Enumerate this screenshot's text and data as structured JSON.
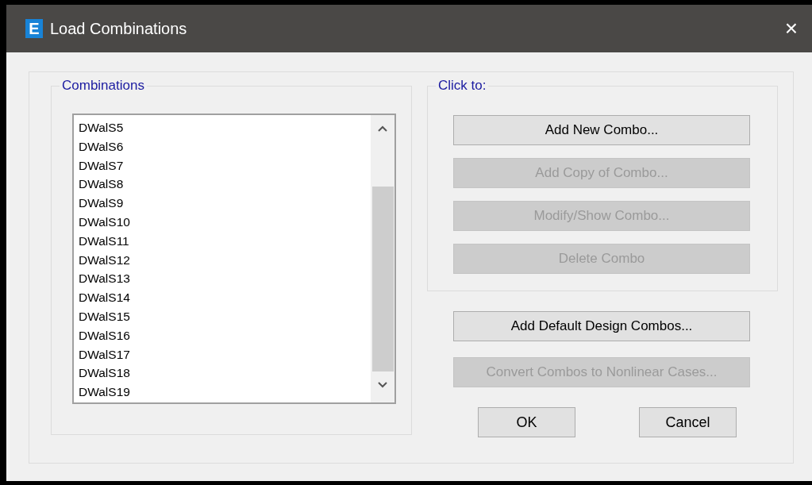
{
  "window": {
    "title": "Load Combinations",
    "icon_letter": "E",
    "close": "×"
  },
  "combinations": {
    "label": "Combinations",
    "items": [
      "DWalS5",
      "DWalS6",
      "DWalS7",
      "DWalS8",
      "DWalS9",
      "DWalS10",
      "DWalS11",
      "DWalS12",
      "DWalS13",
      "DWalS14",
      "DWalS15",
      "DWalS16",
      "DWalS17",
      "DWalS18",
      "DWalS19"
    ]
  },
  "click_to": {
    "label": "Click to:",
    "buttons": [
      {
        "label": "Add New Combo...",
        "disabled": false
      },
      {
        "label": "Add Copy of Combo...",
        "disabled": true
      },
      {
        "label": "Modify/Show Combo...",
        "disabled": true
      },
      {
        "label": "Delete Combo",
        "disabled": true
      }
    ]
  },
  "extra_buttons": [
    {
      "label": "Add Default Design Combos...",
      "disabled": false
    },
    {
      "label": "Convert Combos to Nonlinear Cases...",
      "disabled": true
    }
  ],
  "dialog_buttons": [
    "OK",
    "Cancel"
  ]
}
